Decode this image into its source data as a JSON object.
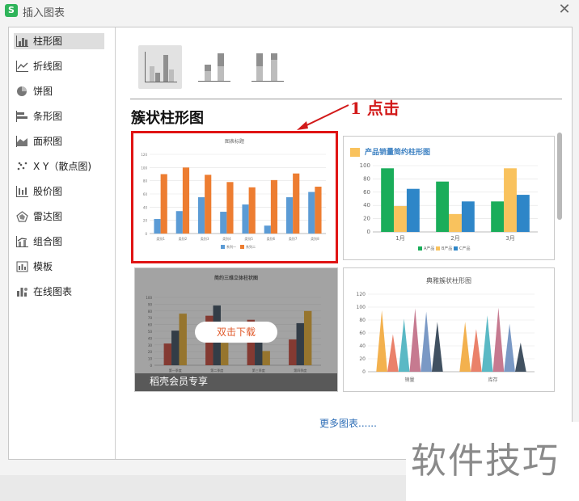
{
  "window": {
    "title": "插入图表",
    "app_icon": "S"
  },
  "sidebar": {
    "items": [
      {
        "label": "柱形图",
        "icon": "column-chart-icon",
        "selected": true
      },
      {
        "label": "折线图",
        "icon": "line-chart-icon"
      },
      {
        "label": "饼图",
        "icon": "pie-chart-icon"
      },
      {
        "label": "条形图",
        "icon": "bar-chart-icon"
      },
      {
        "label": "面积图",
        "icon": "area-chart-icon"
      },
      {
        "label": "X Y（散点图)",
        "icon": "scatter-chart-icon"
      },
      {
        "label": "股价图",
        "icon": "stock-chart-icon"
      },
      {
        "label": "雷达图",
        "icon": "radar-chart-icon"
      },
      {
        "label": "组合图",
        "icon": "combo-chart-icon"
      },
      {
        "label": "模板",
        "icon": "template-icon"
      },
      {
        "label": "在线图表",
        "icon": "online-chart-icon"
      }
    ]
  },
  "subtypes": [
    {
      "name": "clustered-column",
      "selected": true
    },
    {
      "name": "stacked-column"
    },
    {
      "name": "percent-stacked-column"
    }
  ],
  "section_heading": "簇状柱形图",
  "annotation": "1 点击",
  "charts": {
    "c1": {
      "title": "图表标题",
      "categories": [
        "类别1",
        "类别2",
        "类别3",
        "类别4",
        "类别5",
        "类别6",
        "类别7",
        "类别8"
      ],
      "yticks": [
        "0",
        "20",
        "40",
        "60",
        "80",
        "100",
        "120"
      ],
      "legend": [
        "系列一",
        "系列二"
      ],
      "chart_data": {
        "type": "bar",
        "categories": [
          "类别1",
          "类别2",
          "类别3",
          "类别4",
          "类别5",
          "类别6",
          "类别7",
          "类别8"
        ],
        "series": [
          {
            "name": "系列一",
            "values": [
              22,
              34,
              55,
              33,
              44,
              12,
              55,
              63
            ]
          },
          {
            "name": "系列二",
            "values": [
              90,
              100,
              89,
              78,
              70,
              81,
              91,
              71
            ]
          }
        ],
        "ylim": [
          0,
          120
        ]
      }
    },
    "c2": {
      "title": "产品销量简约柱形图",
      "categories": [
        "1月",
        "2月",
        "3月"
      ],
      "yticks": [
        "0",
        "20",
        "40",
        "60",
        "80",
        "100"
      ],
      "legend": [
        "A产品",
        "B产品",
        "C产品"
      ],
      "chart_data": {
        "type": "bar",
        "categories": [
          "1月",
          "2月",
          "3月"
        ],
        "series": [
          {
            "name": "A产品",
            "values": [
              96,
              76,
              46
            ]
          },
          {
            "name": "B产品",
            "values": [
              39,
              27,
              96
            ]
          },
          {
            "name": "C产品",
            "values": [
              65,
              46,
              56
            ]
          }
        ],
        "ylim": [
          0,
          100
        ]
      }
    },
    "c3": {
      "title": "简约三维立体柱状图",
      "member_text": "稻壳会员专享",
      "button": "双击下载",
      "categories": [
        "第一季度",
        "第二季度",
        "第三季度",
        "第四季度"
      ],
      "yticks": [
        "0",
        "10",
        "20",
        "30",
        "40",
        "50",
        "60",
        "70",
        "80",
        "90",
        "100"
      ],
      "chart_data": {
        "type": "bar",
        "categories": [
          "第一季度",
          "第二季度",
          "第三季度",
          "第四季度"
        ],
        "series": [
          {
            "values": [
              32,
              73,
              67,
              38
            ]
          },
          {
            "values": [
              51,
              88,
              58,
              62
            ]
          },
          {
            "values": [
              76,
              33,
              21,
              80
            ]
          }
        ],
        "ylim": [
          0,
          100
        ]
      }
    },
    "c4": {
      "title": "典雅簇状柱形图",
      "categories": [
        "销量",
        "库存"
      ],
      "yticks": [
        "0",
        "20",
        "40",
        "60",
        "80",
        "100",
        "120"
      ],
      "chart_data": {
        "type": "bar",
        "categories": [
          "销量",
          "库存"
        ],
        "series": [
          {
            "values": [
              95,
              77
            ]
          },
          {
            "values": [
              58,
              66
            ]
          },
          {
            "values": [
              82,
              87
            ]
          },
          {
            "values": [
              98,
              99
            ]
          },
          {
            "values": [
              93,
              74
            ]
          },
          {
            "values": [
              77,
              45
            ]
          }
        ],
        "ylim": [
          0,
          120
        ]
      }
    }
  },
  "more_link": "更多图表......",
  "watermark": "软件技巧",
  "colors": {
    "accent": "#e01414",
    "link": "#2d6db6",
    "blue": "#5b9bd5",
    "orange": "#ed7d31"
  }
}
